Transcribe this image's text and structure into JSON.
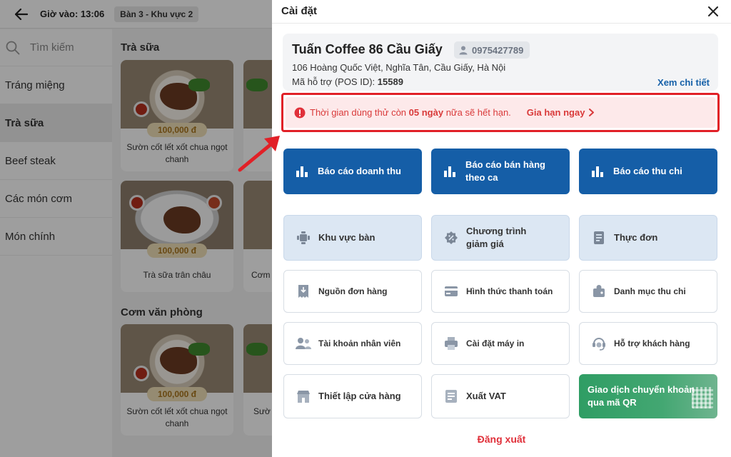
{
  "topbar": {
    "checkin": "Giờ vào: 13:06",
    "table": "Bàn 3 - Khu vực 2"
  },
  "sidebar": {
    "search_placeholder": "Tìm kiếm",
    "items": [
      {
        "label": "Tráng miệng"
      },
      {
        "label": "Trà sữa",
        "active": true
      },
      {
        "label": "Beef steak"
      },
      {
        "label": "Các món cơm"
      },
      {
        "label": "Món chính"
      }
    ]
  },
  "menu": {
    "sections": [
      {
        "title": "Trà sữa"
      },
      {
        "title": "Cơm văn phòng"
      }
    ],
    "cards": [
      {
        "price": "100,000 đ",
        "name": "Sườn cốt lết xốt chua ngọt chanh"
      },
      {
        "price": "100,000 đ",
        "name": "Trà sữa trân châu"
      },
      {
        "price": "100,000 đ",
        "name": "Sườn cốt lết xốt chua ngọt chanh"
      }
    ],
    "partial_names": [
      "Cơm",
      "Sườ"
    ]
  },
  "panel": {
    "title": "Cài đặt",
    "store": {
      "name": "Tuấn Coffee 86 Cầu Giấy",
      "phone": "0975427789",
      "address": "106 Hoàng Quốc Việt, Nghĩa Tân, Cầu Giấy, Hà Nội",
      "pos_label": "Mã hỗ trợ (POS ID):",
      "pos_id": "15589",
      "detail_link": "Xem chi tiết"
    },
    "trial": {
      "text_before": "Thời gian dùng thử còn ",
      "days": "05 ngày",
      "text_after": " nữa sẽ hết hạn.",
      "renew": "Gia hạn ngay"
    },
    "reports": [
      {
        "label": "Báo cáo doanh thu",
        "icon": "bar-chart-icon"
      },
      {
        "label": "Báo cáo bán hàng theo ca",
        "icon": "bar-chart-icon"
      },
      {
        "label": "Báo cáo thu chi",
        "icon": "bar-chart-icon"
      }
    ],
    "settings": [
      {
        "label": "Khu vực bàn",
        "icon": "table-area-icon"
      },
      {
        "label": "Chương trình giảm giá",
        "icon": "discount-icon"
      },
      {
        "label": "Thực đơn",
        "icon": "menu-book-icon"
      },
      {
        "label": "Nguồn đơn hàng",
        "icon": "order-source-icon"
      },
      {
        "label": "Hình thức thanh toán",
        "icon": "payment-card-icon"
      },
      {
        "label": "Danh mục thu chi",
        "icon": "wallet-icon"
      },
      {
        "label": "Tài khoản nhân viên",
        "icon": "staff-icon"
      },
      {
        "label": "Cài đặt máy in",
        "icon": "printer-icon"
      },
      {
        "label": "Hỗ trợ khách hàng",
        "icon": "support-icon"
      },
      {
        "label": "Thiết lập cửa hàng",
        "icon": "store-icon"
      },
      {
        "label": "Xuất VAT",
        "icon": "invoice-icon"
      }
    ],
    "qr_tile": {
      "label": "Giao dịch chuyển khoản qua mã QR"
    },
    "logout": "Đăng xuất"
  },
  "colors": {
    "primary": "#155ea7",
    "light_tile": "#dce7f3",
    "alert_red": "#e12027",
    "alert_bg": "#fde9ea",
    "qr_green": "#2f9d64",
    "price_badge": "#f1e1b8"
  }
}
